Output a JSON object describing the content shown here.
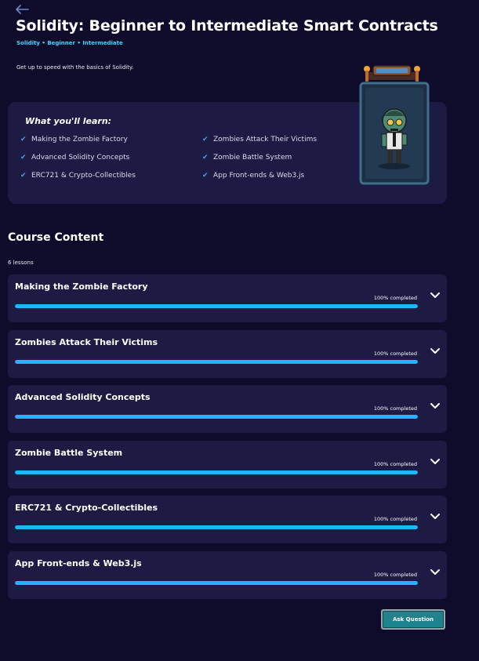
{
  "header": {
    "back_icon": "arrow-left-icon",
    "title": "Solidity: Beginner to Intermediate Smart Contracts",
    "tags": "Solidity • Beginner • Intermediate",
    "description": "Get up to speed with the basics of Solidity."
  },
  "learn": {
    "title": "What you'll learn:",
    "items": [
      "Making the Zombie Factory",
      "Advanced Solidity Concepts",
      "ERC721 & Crypto-Collectibles",
      "Zombies Attack Their Victims",
      "Zombie Battle System",
      "App Front-ends & Web3.js"
    ],
    "check_icon": "check-icon"
  },
  "course": {
    "title": "Course Content",
    "count": "6 lessons",
    "lessons": [
      {
        "title": "Making the Zombie Factory",
        "status": "100% completed",
        "progress": 1.0
      },
      {
        "title": "Zombies Attack Their Victims",
        "status": "100% completed",
        "progress": 1.0
      },
      {
        "title": "Advanced Solidity Concepts",
        "status": "100% completed",
        "progress": 1.0
      },
      {
        "title": "Zombie Battle System",
        "status": "100% completed",
        "progress": 1.0
      },
      {
        "title": "ERC721 & Crypto-Collectibles",
        "status": "100% completed",
        "progress": 1.0
      },
      {
        "title": "App Front-ends & Web3.js",
        "status": "100% completed",
        "progress": 1.0
      }
    ]
  },
  "actions": {
    "ask_question": "Ask Question"
  },
  "colors": {
    "background": "#0f0c2b",
    "panel": "#1d1a43",
    "accent": "#1fb6ff",
    "tag": "#43d3ff"
  }
}
